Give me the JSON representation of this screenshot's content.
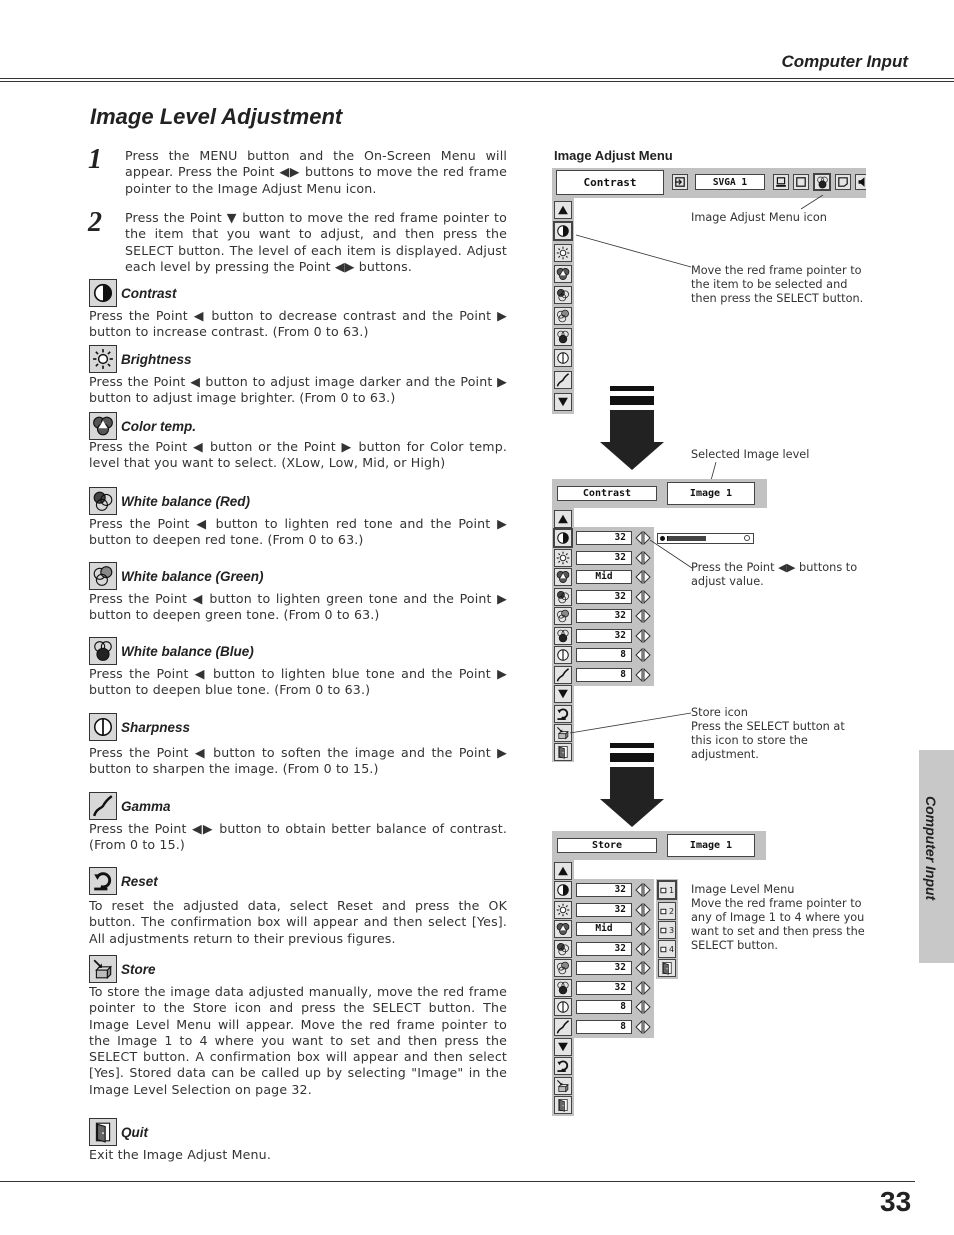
{
  "header": {
    "section": "Computer Input",
    "page_title": "Image Level Adjustment",
    "side_tab": "Computer Input",
    "page_number": "33"
  },
  "steps": [
    {
      "number": "1",
      "text": "Press the MENU button and the On-Screen Menu will appear.  Press the Point ◀▶ buttons to move the red frame pointer to the Image Adjust Menu icon."
    },
    {
      "number": "2",
      "text": "Press the Point ▼ button to move the red frame pointer to the item that you want to adjust, and then press the SELECT button.  The level of each item is displayed.  Adjust each level by pressing the Point ◀▶ buttons."
    }
  ],
  "items": [
    {
      "icon": "contrast-icon",
      "title": "Contrast",
      "text": "Press the Point ◀  button to decrease contrast and the Point ▶ button to increase contrast.  (From 0 to 63.)"
    },
    {
      "icon": "brightness-icon",
      "title": "Brightness",
      "text": "Press the Point ◀ button to adjust image darker and the Point ▶ button to adjust image brighter.  (From 0 to 63.)"
    },
    {
      "icon": "color-temp-icon",
      "title": "Color temp.",
      "text": "Press the Point ◀ button or the Point ▶ button for Color temp. level that you want to select. (XLow, Low, Mid, or High)"
    },
    {
      "icon": "white-balance-red-icon",
      "title": "White balance (Red)",
      "text": "Press the Point ◀ button to lighten red tone and the Point ▶ button to deepen red tone.  (From 0 to 63.)"
    },
    {
      "icon": "white-balance-green-icon",
      "title": "White balance (Green)",
      "text": "Press the Point ◀ button to lighten green tone and the Point ▶ button to deepen green tone.  (From 0 to 63.)"
    },
    {
      "icon": "white-balance-blue-icon",
      "title": "White balance (Blue)",
      "text": "Press the Point ◀ button to lighten blue tone and the Point ▶ button to deepen blue tone.  (From 0 to 63.)"
    },
    {
      "icon": "sharpness-icon",
      "title": "Sharpness",
      "text": "Press the Point ◀ button to soften the image and the Point ▶ button to sharpen the image.  (From 0 to 15.)"
    },
    {
      "icon": "gamma-icon",
      "title": "Gamma",
      "text": "Press the Point ◀▶ button to obtain better balance of contrast. (From 0 to 15.)"
    },
    {
      "icon": "reset-icon",
      "title": "Reset",
      "text": "To reset the adjusted data, select Reset and press the OK button. The confirmation box will appear and then select [Yes].  All adjustments return to their previous figures."
    },
    {
      "icon": "store-icon",
      "title": "Store",
      "text": "To store the image data adjusted manually, move the red frame pointer to the Store icon and press the SELECT button.  The Image Level Menu will appear.  Move the red frame pointer to the Image 1 to 4 where you want to set and then press the SELECT button.  A confirmation box will appear and then select [Yes]. Stored data can be called up by selecting \"Image\" in the Image Level Selection on page 32."
    },
    {
      "icon": "quit-icon",
      "title": "Quit",
      "text": "Exit the Image Adjust Menu."
    }
  ],
  "figure": {
    "menu_label": "Image Adjust Menu",
    "menu1": {
      "selected_field": "Contrast",
      "source_field": "SVGA 1",
      "toolbar_icons": [
        "input-icon",
        "pc-adjust-icon",
        "screen-icon",
        "image-adjust-menu-icon",
        "setting-icon",
        "sound-icon"
      ]
    },
    "menu2": {
      "selected_field": "Contrast",
      "image_field": "Image 1",
      "slider_value": 32,
      "slider_max": 63
    },
    "menu3": {
      "selected_field": "Store",
      "image_field": "Image 1",
      "image_slots": [
        "1",
        "2",
        "3",
        "4"
      ]
    },
    "values": [
      "32",
      "32",
      "Mid",
      "32",
      "32",
      "32",
      "8",
      "8"
    ],
    "annotations": {
      "image_adjust_icon": "Image Adjust Menu icon",
      "move_pointer": "Move the red frame pointer to the item to be selected and then press the SELECT button.",
      "selected_level": "Selected Image level",
      "press_point": "Press the Point ◀▶ buttons to adjust value.",
      "store_icon": "Store icon",
      "store_desc": "Press the SELECT button at this icon to store the adjustment.",
      "image_level_menu": "Image Level Menu",
      "image_level_desc": "Move the red frame pointer to any of Image 1 to 4 where you want to set  and then press the SELECT button."
    }
  }
}
